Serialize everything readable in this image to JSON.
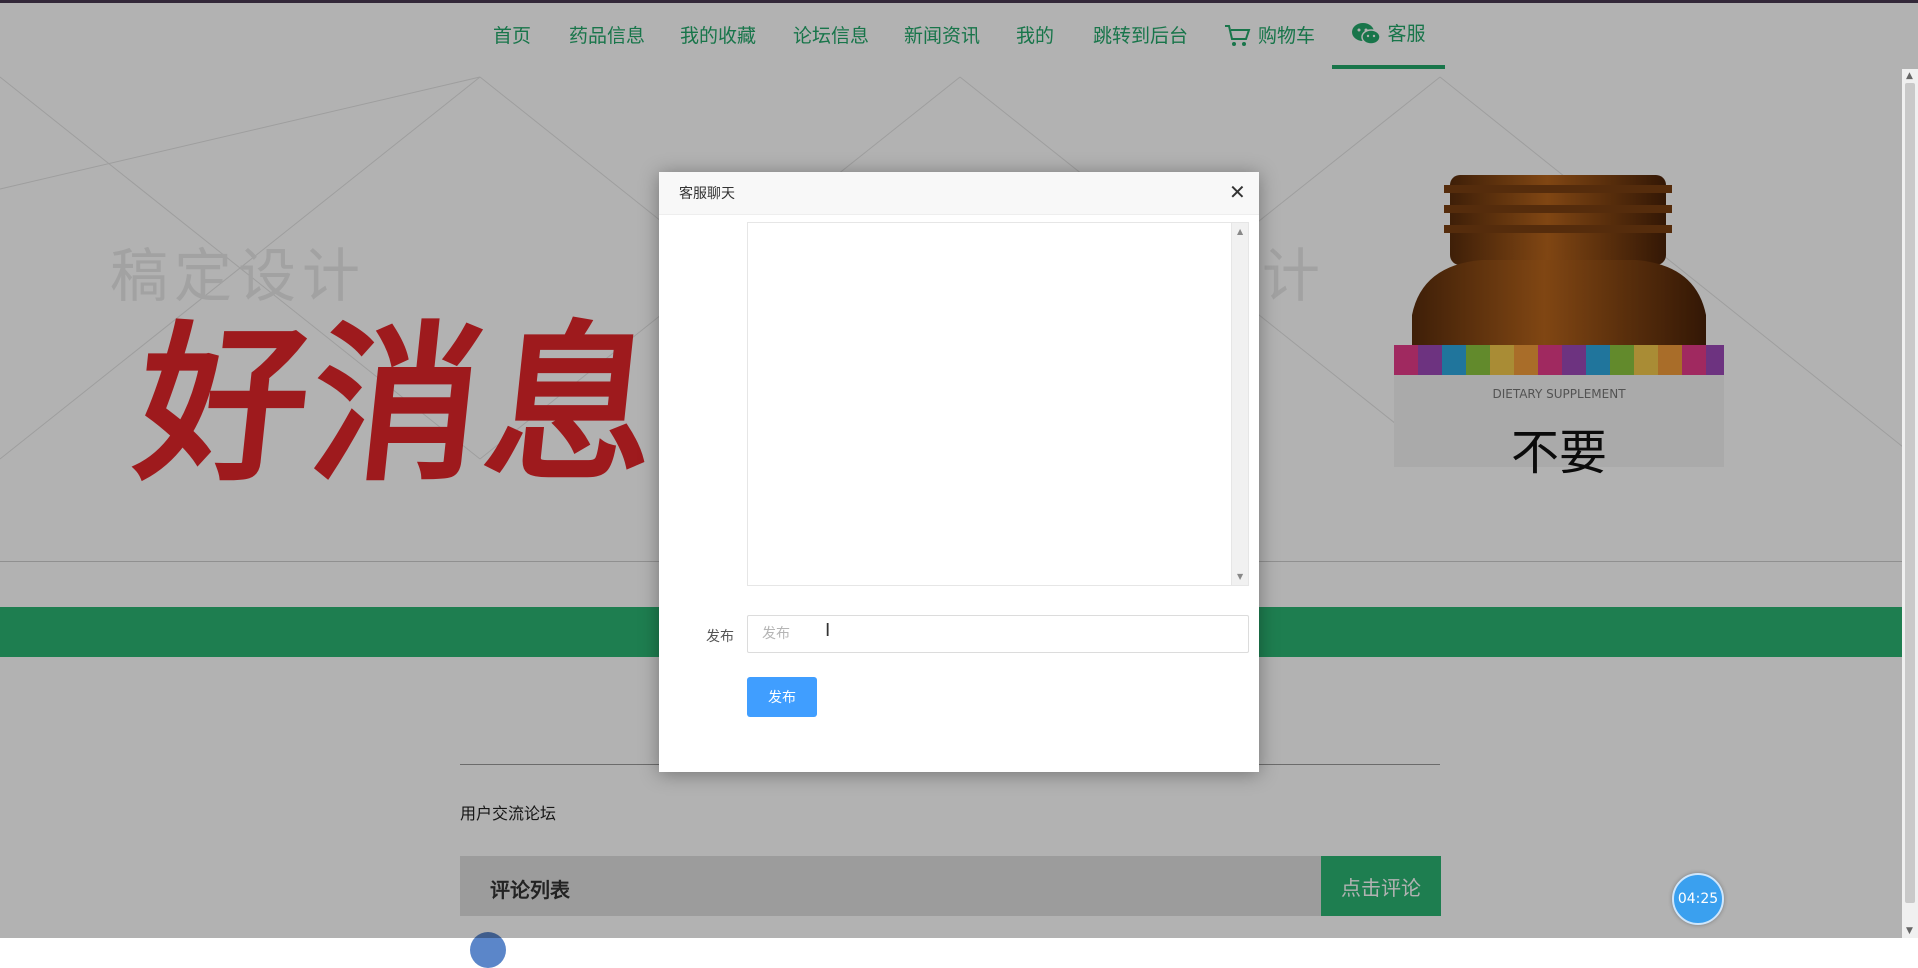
{
  "nav": {
    "items": [
      {
        "label": "首页"
      },
      {
        "label": "药品信息"
      },
      {
        "label": "我的收藏"
      },
      {
        "label": "论坛信息"
      },
      {
        "label": "新闻资讯"
      },
      {
        "label": "我的"
      },
      {
        "label": "跳转到后台"
      },
      {
        "label": "购物车",
        "icon": "cart-icon"
      },
      {
        "label": "客服",
        "icon": "wechat-icon"
      }
    ],
    "active": "客服",
    "accent_color": "#23a86b"
  },
  "banner": {
    "headline": "好消息",
    "watermark_left": "稿定设计",
    "watermark_right": "计",
    "bottle_text_en": "DIETARY SUPPLEMENT",
    "bottle_text_cn": "不要"
  },
  "forum": {
    "title": "用户交流论坛",
    "comment_list_label": "评论列表",
    "comment_button": "点击评论"
  },
  "dialog": {
    "title": "客服聊天",
    "close_symbol": "✕",
    "publish_label": "发布",
    "publish_placeholder": "发布",
    "publish_button": "发布"
  },
  "timer": {
    "value": "04:25"
  }
}
